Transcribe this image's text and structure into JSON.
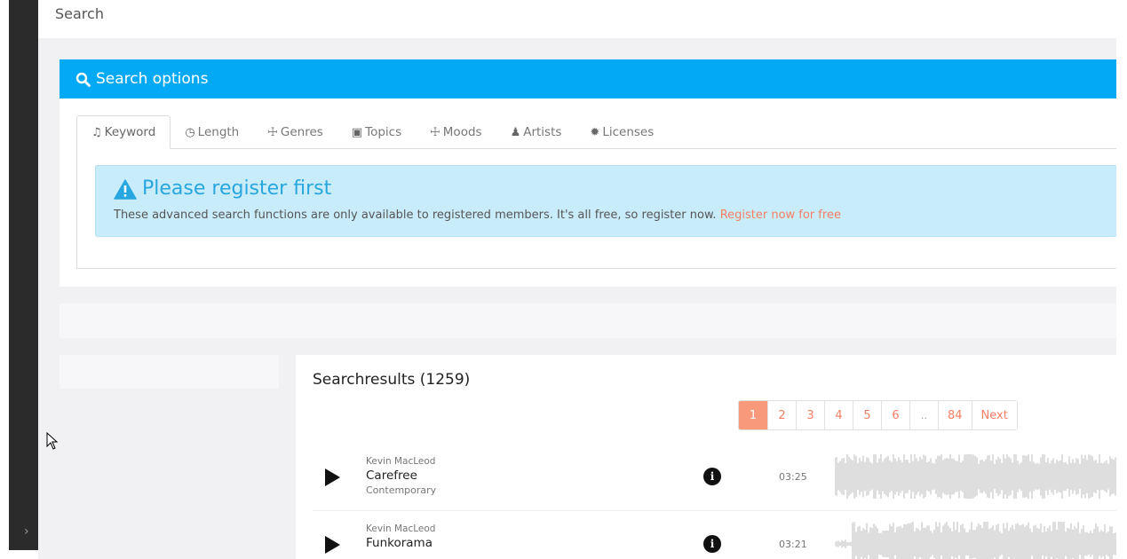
{
  "page": {
    "title": "Search"
  },
  "search_options": {
    "header": "Search options",
    "tabs": [
      {
        "label": "Keyword",
        "icon": "music-note-icon"
      },
      {
        "label": "Length",
        "icon": "clock-icon"
      },
      {
        "label": "Genres",
        "icon": "drums-icon"
      },
      {
        "label": "Topics",
        "icon": "images-icon"
      },
      {
        "label": "Moods",
        "icon": "drums-icon"
      },
      {
        "label": "Artists",
        "icon": "user-icon"
      },
      {
        "label": "Licenses",
        "icon": "certificate-icon"
      }
    ],
    "alert": {
      "title": "Please register first",
      "text": "These advanced search functions are only available to registered members. It's all free, so register now.",
      "link": "Register now for free"
    }
  },
  "results": {
    "title": "Searchresults (1259)",
    "pagination": [
      "1",
      "2",
      "3",
      "4",
      "5",
      "6",
      "..",
      "84",
      "Next"
    ],
    "current_page": "1",
    "tracks": [
      {
        "artist": "Kevin MacLeod",
        "title": "Carefree",
        "genre": "Contemporary",
        "duration": "03:25"
      },
      {
        "artist": "Kevin MacLeod",
        "title": "Funkorama",
        "genre": "",
        "duration": "03:21"
      }
    ]
  },
  "colors": {
    "accent": "#03a9f4",
    "alert_bg": "#c9ecfb",
    "link": "#f47f64",
    "active_page": "#f8997c"
  }
}
